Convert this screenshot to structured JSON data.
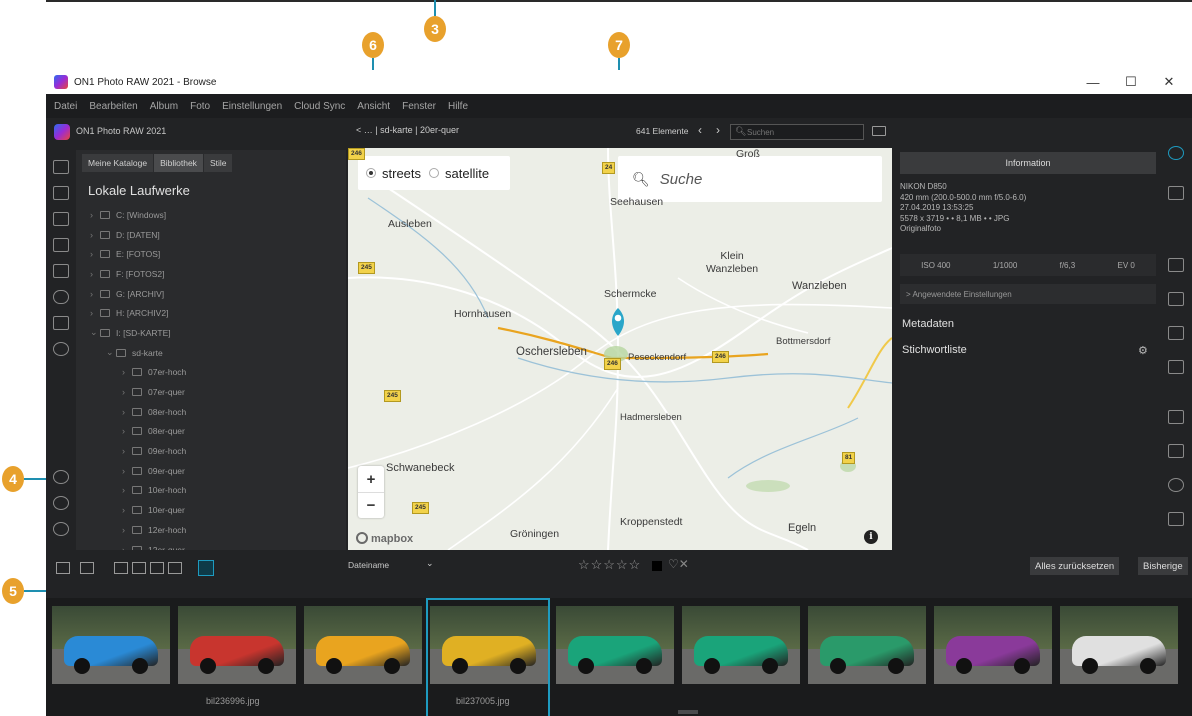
{
  "window": {
    "title": "ON1 Photo RAW 2021 - Browse",
    "controls": [
      "—",
      "☐",
      "✕"
    ]
  },
  "menu": [
    "Datei",
    "Bearbeiten",
    "Album",
    "Foto",
    "Einstellungen",
    "Cloud Sync",
    "Ansicht",
    "Fenster",
    "Hilfe"
  ],
  "toolbar": {
    "brand": "ON1 Photo RAW 2021",
    "path_prefix": "< … | sd-karte | 20er-quer",
    "count": "641 Elemente",
    "search_placeholder": "Suchen"
  },
  "callouts": {
    "c3": "3",
    "c4": "4",
    "c5": "5",
    "c6": "6",
    "c7": "7"
  },
  "library": {
    "tabs": [
      "Meine Kataloge",
      "Bibliothek",
      "Stile"
    ],
    "title": "Lokale Laufwerke",
    "tree": [
      {
        "label": "C: [Windows]",
        "level": 0
      },
      {
        "label": "D: [DATEN]",
        "level": 0
      },
      {
        "label": "E: [FOTOS]",
        "level": 0
      },
      {
        "label": "F: [FOTOS2]",
        "level": 0
      },
      {
        "label": "G: [ARCHIV]",
        "level": 0
      },
      {
        "label": "H: [ARCHIV2]",
        "level": 0
      },
      {
        "label": "I: [SD-KARTE]",
        "level": 0
      },
      {
        "label": "sd-karte",
        "level": 1
      },
      {
        "label": "07er-hoch",
        "level": 2
      },
      {
        "label": "07er-quer",
        "level": 2
      },
      {
        "label": "08er-hoch",
        "level": 2
      },
      {
        "label": "08er-quer",
        "level": 2
      },
      {
        "label": "09er-hoch",
        "level": 2
      },
      {
        "label": "09er-quer",
        "level": 2
      },
      {
        "label": "10er-hoch",
        "level": 2
      },
      {
        "label": "10er-quer",
        "level": 2
      },
      {
        "label": "12er-hoch",
        "level": 2
      },
      {
        "label": "12er-quer",
        "level": 2
      }
    ]
  },
  "map": {
    "style_streets": "streets",
    "style_satellite": "satellite",
    "search_placeholder": "Suche",
    "zoom_in": "+",
    "zoom_out": "−",
    "attribution": "mapbox",
    "info": "i",
    "places": [
      {
        "name": "Groß",
        "k": "p1"
      },
      {
        "name": "Seehausen",
        "k": "p2"
      },
      {
        "name": "Ausleben",
        "k": "p3"
      },
      {
        "name": "Klein\nWanzleben",
        "k": "p4"
      },
      {
        "name": "Wanzleben",
        "k": "p5"
      },
      {
        "name": "Schermcke",
        "k": "p6"
      },
      {
        "name": "Hornhausen",
        "k": "p7"
      },
      {
        "name": "Bottmersdorf",
        "k": "p8"
      },
      {
        "name": "Oschersleben",
        "k": "p9"
      },
      {
        "name": "Peseckendorf",
        "k": "p10"
      },
      {
        "name": "Hadmersleben",
        "k": "p11"
      },
      {
        "name": "Schwanebeck",
        "k": "p12"
      },
      {
        "name": "Kroppenstedt",
        "k": "p13"
      },
      {
        "name": "Egeln",
        "k": "p14"
      },
      {
        "name": "Gröningen",
        "k": "p15"
      }
    ],
    "shields": [
      "246",
      "24",
      "245",
      "246",
      "246",
      "245",
      "81",
      "245"
    ]
  },
  "info_panel": {
    "header": "Information",
    "camera": "NIKON D850",
    "lens": "420 mm (200.0-500.0 mm f/5.0-6.0)",
    "date": "27.04.2019 13:53:25",
    "size": "5578 x 3719 • • 8,1 MB • • JPG",
    "kind": "Originalfoto",
    "iso": "ISO 400",
    "shutter": "1/1000",
    "aperture": "f/6,3",
    "ev": "EV 0",
    "applied": "> Angewendete Einstellungen",
    "metadata": "Metadaten",
    "keywords": "Stichwortliste"
  },
  "sortbar": {
    "sort_label": "Dateiname",
    "stars": "☆☆☆☆☆",
    "reset": "Alles zurücksetzen",
    "previous": "Bisherige"
  },
  "filmstrip": {
    "name_left": "bil236996.jpg",
    "name_selected": "bil237005.jpg",
    "cars": [
      "#2a8ad6",
      "#c8352e",
      "#e9a41f",
      "#e0b023",
      "#1aa47a",
      "#1aa47a",
      "#2a9a6a",
      "#8a3a9a",
      "#e0e0e0"
    ]
  },
  "colors": {
    "accent": "#1e9bc0",
    "callout": "#e8a12c",
    "pin": "#2aa6c9"
  }
}
